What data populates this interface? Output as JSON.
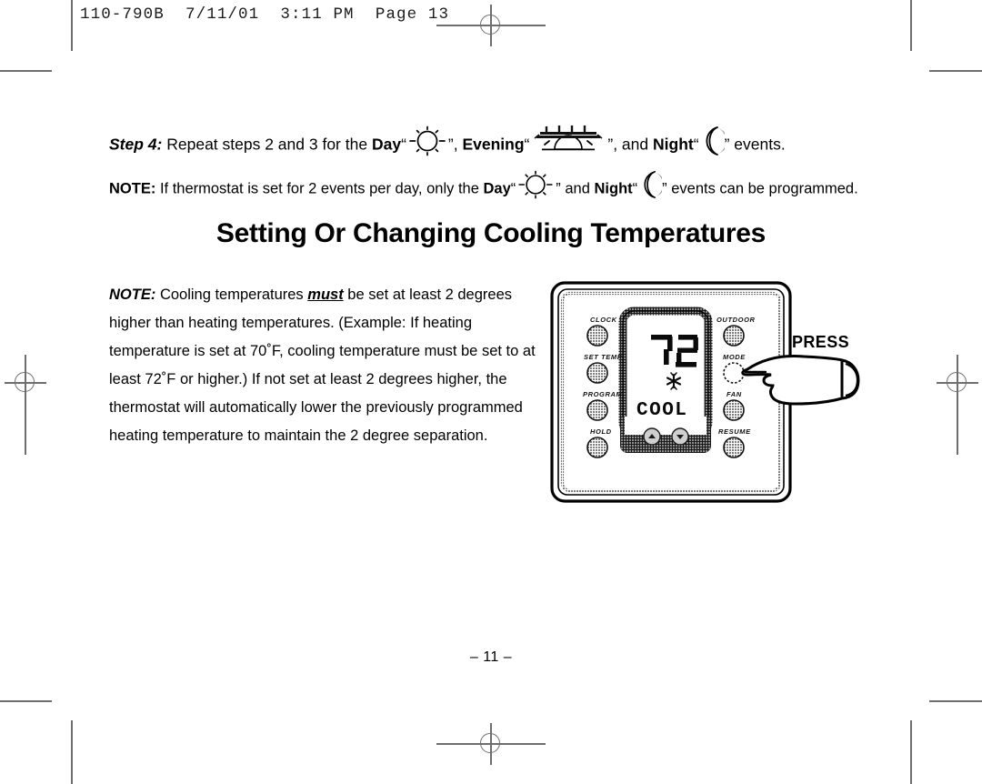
{
  "page": {
    "slug": "110-790B  7/11/01  3:11 PM  Page 13",
    "page_number": "– 11 –",
    "section_title": "Setting Or Changing Cooling Temperatures"
  },
  "step4": {
    "label": "Step 4:",
    "text_a": "Repeat steps 2 and 3 for the",
    "day_label": "Day",
    "quote_open": "“",
    "quote_close": "”",
    "comma": ",",
    "evening_label": "Evening",
    "text_b": ", and",
    "night_label": "Night",
    "text_c": "events.",
    "day_icon": "sun-icon",
    "evening_icon": "sunset-icon",
    "night_icon": "crescent-moon-icon"
  },
  "note_top": {
    "label": "NOTE:",
    "text_a": "If thermostat is set for 2 events per day, only the",
    "day_label": "Day",
    "text_b": "and",
    "night_label": "Night",
    "text_c": "events can be programmed.",
    "day_icon": "sun-icon",
    "night_icon": "crescent-moon-icon"
  },
  "body_note": {
    "label": "NOTE:",
    "part1": "Cooling temperatures",
    "emphasis": "must",
    "part2": "be set at least 2 degrees higher than heating temperatures. (Example: If heating temperature is set at 70˚F, cooling temperature must be set to at least 72˚F or higher.) If not set at least 2 degrees higher, the thermostat will automatically lower the previously programmed heating temperature to maintain the 2 degree separation."
  },
  "thermostat": {
    "left_buttons": [
      {
        "label": "CLOCK",
        "name": "clock-button"
      },
      {
        "label": "SET TEMP",
        "name": "set-temp-button"
      },
      {
        "label": "PROGRAM",
        "name": "program-button"
      },
      {
        "label": "HOLD",
        "name": "hold-button"
      }
    ],
    "right_buttons": [
      {
        "label": "OUTDOOR",
        "name": "outdoor-button"
      },
      {
        "label": "MODE",
        "name": "mode-button"
      },
      {
        "label": "FAN",
        "name": "fan-button"
      },
      {
        "label": "RESUME",
        "name": "resume-button"
      }
    ],
    "display": {
      "temperature": "72",
      "mode_icon": "snowflake-icon",
      "mode_text": "COOL"
    },
    "adjust_buttons": [
      {
        "name": "temp-up-button",
        "icon": "up-arrow-icon"
      },
      {
        "name": "temp-down-button",
        "icon": "down-arrow-icon"
      }
    ],
    "callout": {
      "text": "PRESS",
      "icon": "pointing-hand-icon",
      "target": "mode-button"
    }
  },
  "colors": {
    "ink": "#000000",
    "paper": "#ffffff",
    "crop_mark": "#6e6e6e",
    "button_fill": "#bdbdbd"
  }
}
